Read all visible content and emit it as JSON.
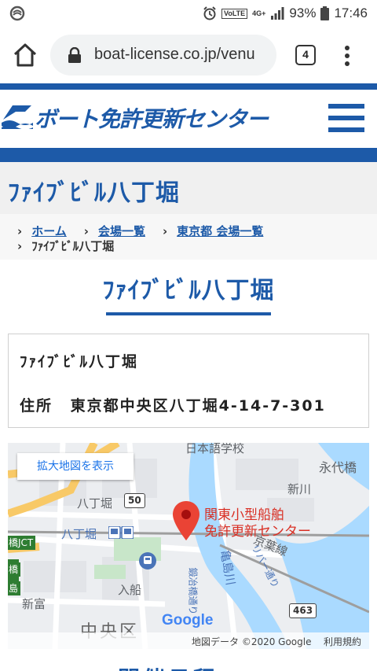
{
  "status_bar": {
    "battery": "93%",
    "time": "17:46",
    "network_badges": [
      "VoLTE",
      "4G+"
    ]
  },
  "browser": {
    "url": "boat-license.co.jp/venu",
    "tab_count": "4"
  },
  "site": {
    "logo_text": "ボート免許更新センター"
  },
  "page": {
    "title": "ﾌｧｲﾌﾞﾋﾞﾙ八丁堀",
    "heading": "ﾌｧｲﾌﾞﾋﾞﾙ八丁堀"
  },
  "breadcrumb": {
    "sep": "›",
    "links": [
      "ホーム",
      "会場一覧",
      "東京都 会場一覧"
    ],
    "current": "ﾌｧｲﾌﾞﾋﾞﾙ八丁堀"
  },
  "venue_info": {
    "name": "ﾌｧｲﾌﾞﾋﾞﾙ八丁堀",
    "address_label": "住所",
    "address": "東京都中央区八丁堀4-14-7-301"
  },
  "map": {
    "expand_label": "拡大地図を表示",
    "marker_label_line1": "関東小型船舶",
    "marker_label_line2": "免許更新センター",
    "labels": {
      "school": "日本語学校",
      "eitaibashi": "永代橋",
      "shinkawa": "新川",
      "hatchobori_top": "八丁堀",
      "hatchobori_station": "八丁堀",
      "keiyo_line": "京葉線",
      "river": "亀島川",
      "river_road": "リバー通り",
      "jct": "橋JCT",
      "irifune": "入船",
      "shintomi": "新富",
      "chuo_ku": "中央区",
      "side_left": "橋",
      "side_left2": "島",
      "road_name": "鍛冶橋通り"
    },
    "route_50": "50",
    "route_463": "463",
    "google_text": "Google",
    "attribution_data": "地図データ ©2020 Google",
    "attribution_terms": "利用規約"
  },
  "next_section_peek": "開催日程"
}
